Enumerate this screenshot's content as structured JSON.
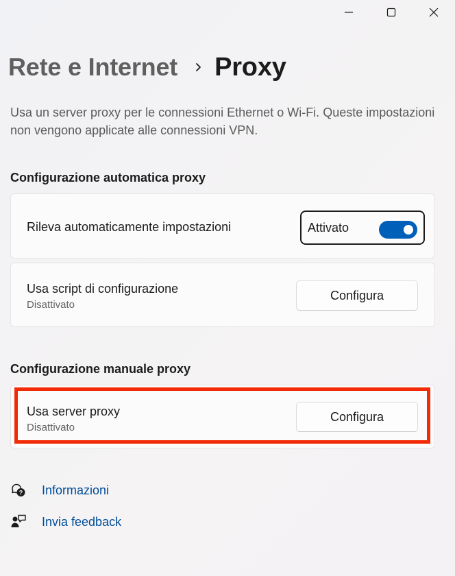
{
  "window": {
    "controls": [
      "minimize-icon",
      "maximize-icon",
      "close-icon"
    ]
  },
  "breadcrumb": {
    "parent": "Rete e Internet",
    "separator_icon": "chevron-right-icon",
    "current": "Proxy"
  },
  "description": "Usa un server proxy per le connessioni Ethernet o Wi-Fi. Queste impostazioni non vengono applicate alle connessioni VPN.",
  "auto_proxy": {
    "title": "Configurazione automatica proxy",
    "detect": {
      "label": "Rileva automaticamente impostazioni",
      "toggle_label": "Attivato",
      "toggle_on": true
    },
    "script": {
      "label": "Usa script di configurazione",
      "status": "Disattivato",
      "button": "Configura"
    }
  },
  "manual_proxy": {
    "title": "Configurazione manuale proxy",
    "server": {
      "label": "Usa server proxy",
      "status": "Disattivato",
      "button": "Configura"
    }
  },
  "links": {
    "info": "Informazioni",
    "feedback": "Invia feedback"
  },
  "colors": {
    "accent": "#005fb8",
    "highlight": "#f22a05",
    "link": "#004c99"
  }
}
